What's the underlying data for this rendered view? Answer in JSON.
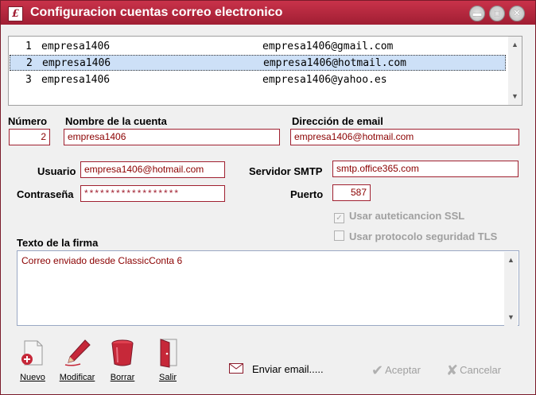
{
  "window": {
    "title": "Configuracion cuentas correo electronico"
  },
  "accounts": [
    {
      "n": "1",
      "name": "empresa1406",
      "email": "empresa1406@gmail.com"
    },
    {
      "n": "2",
      "name": "empresa1406",
      "email": "empresa1406@hotmail.com"
    },
    {
      "n": "3",
      "name": "empresa1406",
      "email": "empresa1406@yahoo.es"
    }
  ],
  "form": {
    "numero_label": "Número",
    "numero_value": "2",
    "nombre_label": "Nombre de la cuenta",
    "nombre_value": "empresa1406",
    "direccion_label": "Dirección de email",
    "direccion_value": "empresa1406@hotmail.com",
    "usuario_label": "Usuario",
    "usuario_value": "empresa1406@hotmail.com",
    "contrasena_label": "Contraseña",
    "contrasena_value": "******************",
    "smtp_label": "Servidor SMTP",
    "smtp_value": "smtp.office365.com",
    "puerto_label": "Puerto",
    "puerto_value": "587",
    "ssl_label": "Usar auteticancion SSL",
    "ssl_checked": true,
    "tls_label": "Usar protocolo seguridad TLS",
    "tls_checked": false,
    "firma_label": "Texto de la firma",
    "firma_value": "Correo enviado desde ClassicConta 6"
  },
  "toolbar": {
    "nuevo": "Nuevo",
    "modificar": "Modificar",
    "borrar": "Borrar",
    "salir": "Salir",
    "enviar": "Enviar email.....",
    "aceptar": "Aceptar",
    "cancelar": "Cancelar"
  },
  "icons": {
    "app": "app-logo-icon",
    "minimize": "minimize-icon",
    "maximize": "maximize-icon",
    "close": "close-icon",
    "nuevo": "new-document-icon",
    "modificar": "pen-icon",
    "borrar": "trash-bin-icon",
    "salir": "exit-door-icon",
    "enviar": "envelope-icon",
    "aceptar": "checkmark-icon",
    "cancelar": "x-icon"
  },
  "colors": {
    "accent": "#a01e33",
    "selection": "#cde0f7",
    "field_text": "#8b0000"
  }
}
